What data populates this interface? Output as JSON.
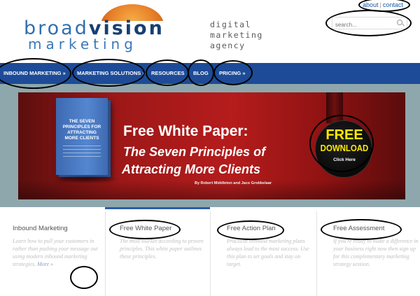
{
  "header": {
    "logo_word1_a": "broad",
    "logo_word1_b": "vision",
    "logo_word2": "marketing",
    "tagline_line1": "digital",
    "tagline_line2": "marketing",
    "tagline_line3": "agency",
    "top_links": {
      "about": "about",
      "separator": "|",
      "contact": "contact"
    },
    "search_placeholder": "search..."
  },
  "nav": {
    "items": [
      {
        "label": "INBOUND MARKETING »"
      },
      {
        "label": "MARKETING SOLUTIONS »"
      },
      {
        "label": "RESOURCES"
      },
      {
        "label": "BLOG"
      },
      {
        "label": "PRICING »"
      }
    ]
  },
  "banner": {
    "book_title": "THE SEVEN PRINCIPLES FOR ATTRACTING MORE CLIENTS",
    "heading": "Free White Paper:",
    "subheading_line1": "The Seven Principles of",
    "subheading_line2": "Attracting More Clients",
    "author": "By Robert Middleton and Jaco Grobbelaar",
    "seal_free": "FREE",
    "seal_download": "DOWNLOAD",
    "seal_click": "Click Here"
  },
  "columns": [
    {
      "title": "Inbound Marketing",
      "text": "Learn how to pull your customers in rather than pushing your message out using modern inbound marketing strategies.",
      "more": "More »"
    },
    {
      "title": "Free White Paper",
      "text": "The most market according to proven principles. This white paper outlines these principles.",
      "more": ""
    },
    {
      "title": "Free Action Plan",
      "text": "Practical inbound marketing plans always lead to the most success. Use this plan to set goals and stay on target.",
      "more": ""
    },
    {
      "title": "Free Assessment",
      "text": "If you're ready to make a difference in your business right now then sign up for this complementary marketing strategy session.",
      "more": ""
    }
  ],
  "colors": {
    "nav_background": "#1d4b97",
    "banner_red": "#b51c1c",
    "brand_blue": "#2f6fb0",
    "logo_sun": "#e8812a",
    "seal_text": "#ffea00"
  }
}
